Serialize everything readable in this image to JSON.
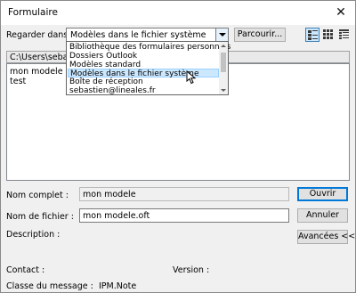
{
  "window": {
    "title": "Formulaire"
  },
  "look_in": {
    "label": "Regarder dans :",
    "selected": "Modèles dans le fichier système",
    "options": [
      "Bibliothèque des formulaires personnels",
      "Dossiers Outlook",
      "Modèles standard",
      "Modèles dans le fichier système",
      "Boîte de réception",
      "sebastien@lineales.fr"
    ],
    "highlighted_index": 3
  },
  "toolbar": {
    "browse_label": "Parcourir...",
    "views": [
      "large-icons-view",
      "small-icons-view",
      "details-view"
    ]
  },
  "path": "C:\\Users\\sebas\\A",
  "file_list": [
    "mon modele",
    "test"
  ],
  "form": {
    "full_name_label": "Nom complet :",
    "full_name_value": "mon modele",
    "file_name_label": "Nom de fichier :",
    "file_name_value": "mon modele.oft",
    "description_label": "Description :",
    "contact_label": "Contact :",
    "version_label": "Version :",
    "message_class_label": "Classe du message :",
    "message_class_value": "IPM.Note"
  },
  "buttons": {
    "open": "Ouvrir",
    "cancel": "Annuler",
    "advanced": "Avancées <<"
  }
}
